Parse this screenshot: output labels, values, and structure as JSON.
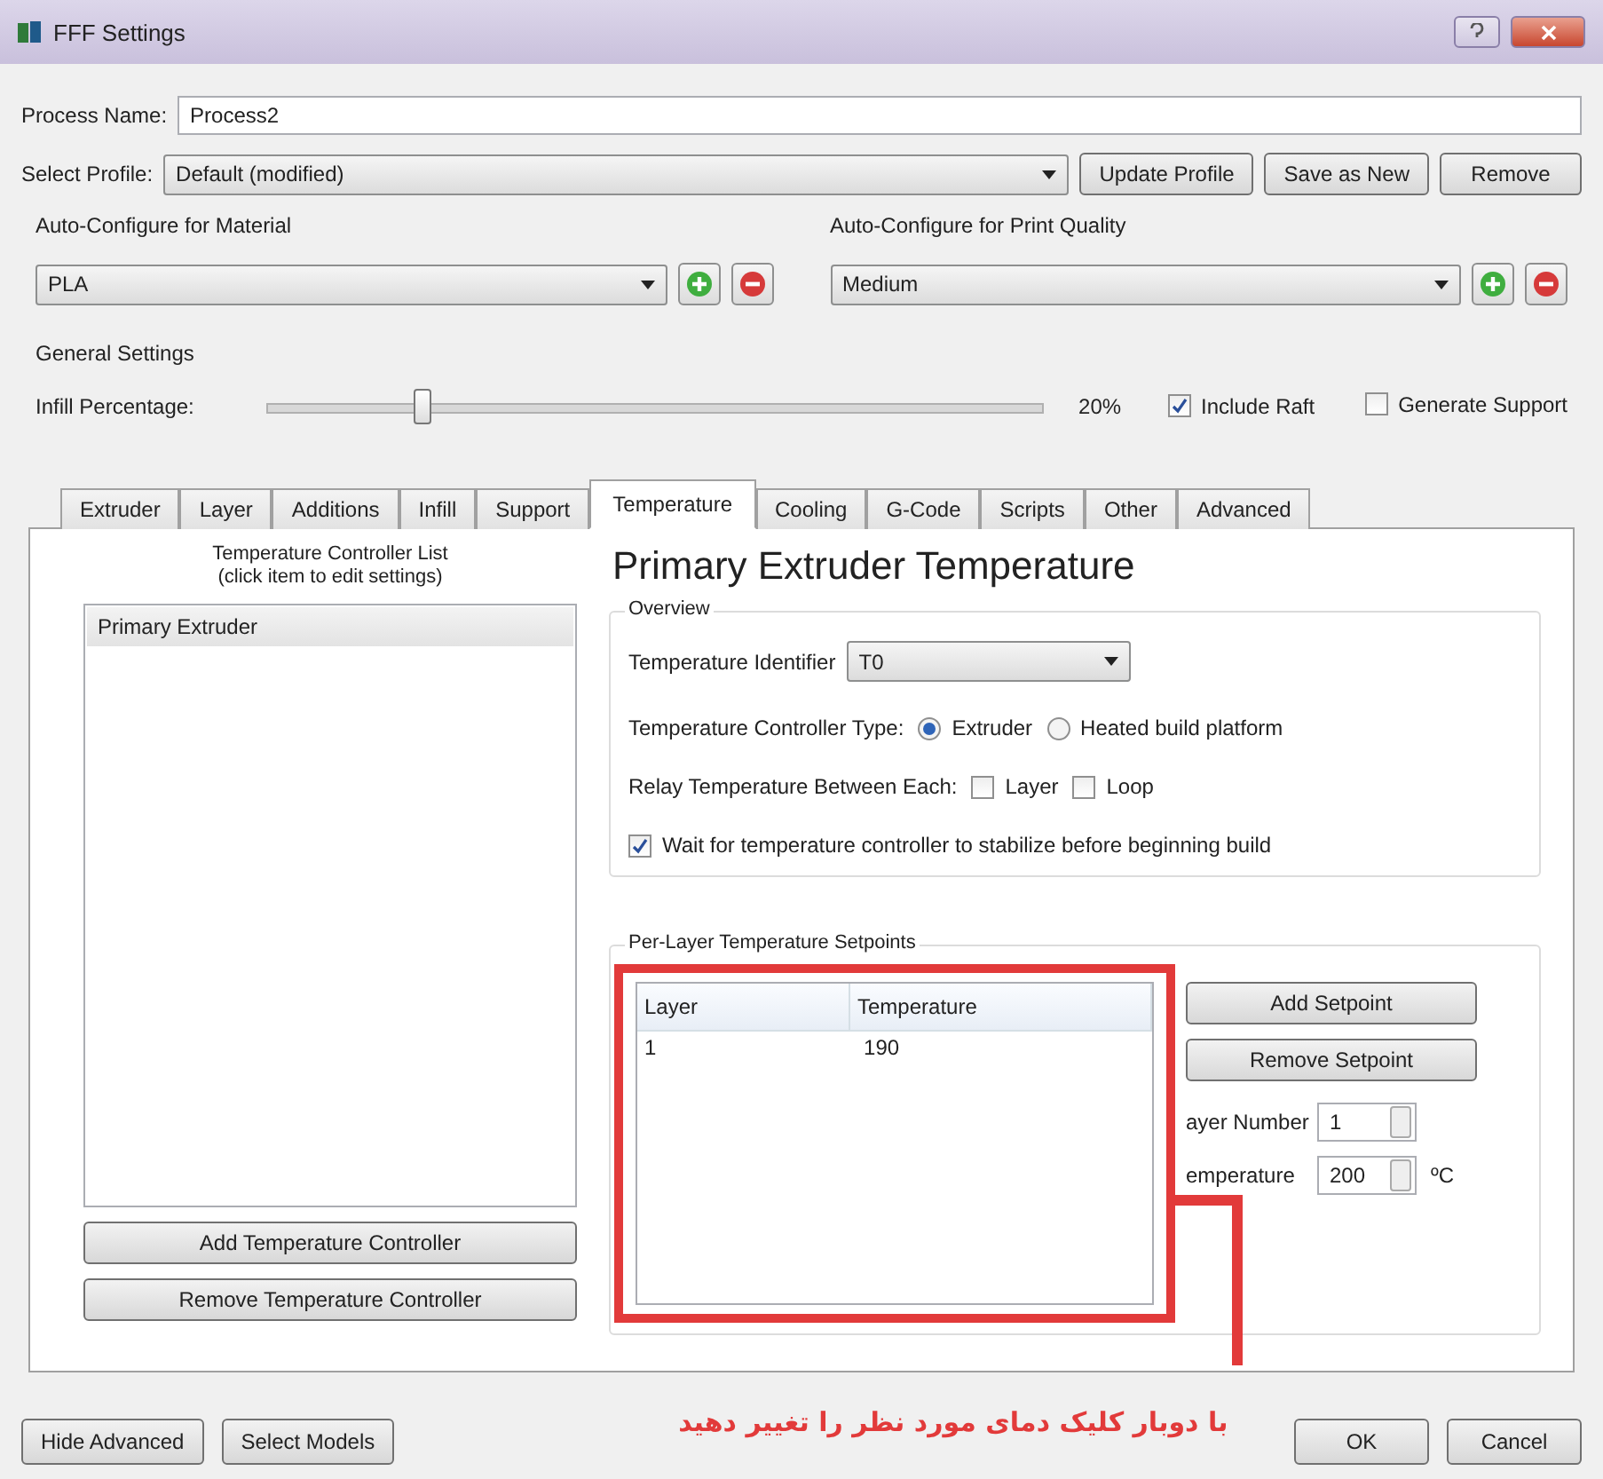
{
  "window": {
    "title": "FFF Settings"
  },
  "process_name": {
    "label": "Process Name:",
    "value": "Process2"
  },
  "profile": {
    "label": "Select Profile:",
    "value": "Default (modified)",
    "buttons": [
      "Update Profile",
      "Save as New",
      "Remove"
    ]
  },
  "auto_configure": [
    {
      "title": "Auto-Configure for Material",
      "value": "PLA"
    },
    {
      "title": "Auto-Configure for Print Quality",
      "value": "Medium"
    }
  ],
  "general": {
    "title": "General Settings",
    "infill_label": "Infill Percentage:",
    "level": 0.2,
    "reading": "20%",
    "options": [
      {
        "label": "Include Raft",
        "checked": true
      },
      {
        "label": "Generate Support",
        "checked": false
      }
    ]
  },
  "tabs": [
    {
      "label": "Extruder",
      "selected": false
    },
    {
      "label": "Layer",
      "selected": false
    },
    {
      "label": "Additions",
      "selected": false
    },
    {
      "label": "Infill",
      "selected": false
    },
    {
      "label": "Support",
      "selected": false
    },
    {
      "label": "Temperature",
      "selected": true
    },
    {
      "label": "Cooling",
      "selected": false
    },
    {
      "label": "G-Code",
      "selected": false
    },
    {
      "label": "Scripts",
      "selected": false
    },
    {
      "label": "Other",
      "selected": false
    },
    {
      "label": "Advanced",
      "selected": false
    }
  ],
  "controller_list": {
    "caption": [
      "Temperature Controller List",
      "(click item to edit settings)"
    ],
    "items": [
      {
        "label": "Primary Extruder",
        "selected": true
      }
    ],
    "buttons": [
      "Add Temperature Controller",
      "Remove Temperature Controller"
    ]
  },
  "detail": {
    "title": "Primary Extruder Temperature",
    "overview": {
      "title": "Overview",
      "identifier_label": "Temperature Identifier",
      "identifier_value": "T0",
      "type_label": "Temperature Controller Type:",
      "types": [
        {
          "label": "Extruder",
          "selected": true
        },
        {
          "label": "Heated build platform",
          "selected": false
        }
      ],
      "relay_label": "Relay Temperature Between Each:",
      "relay": [
        {
          "label": "Layer",
          "checked": false
        },
        {
          "label": "Loop",
          "checked": false
        }
      ],
      "wait": {
        "label": "Wait for temperature controller to stabilize before beginning build",
        "checked": true
      }
    },
    "setpoints": {
      "title": "Per-Layer Temperature Setpoints",
      "columns": [
        "Layer",
        "Temperature"
      ],
      "rows": [
        [
          "1",
          "190"
        ]
      ],
      "buttons": [
        "Add Setpoint",
        "Remove Setpoint"
      ],
      "layer_label": "ayer Number",
      "layer_value": "1",
      "temp_label": "emperature",
      "temp_value": "200",
      "unit": "ºC"
    }
  },
  "annotation": {
    "text": "با دوبار کلیک دمای مورد نظر را تغییر دهید"
  },
  "footer": {
    "left": [
      "Hide Advanced",
      "Select Models"
    ],
    "right": [
      "OK",
      "Cancel"
    ]
  }
}
